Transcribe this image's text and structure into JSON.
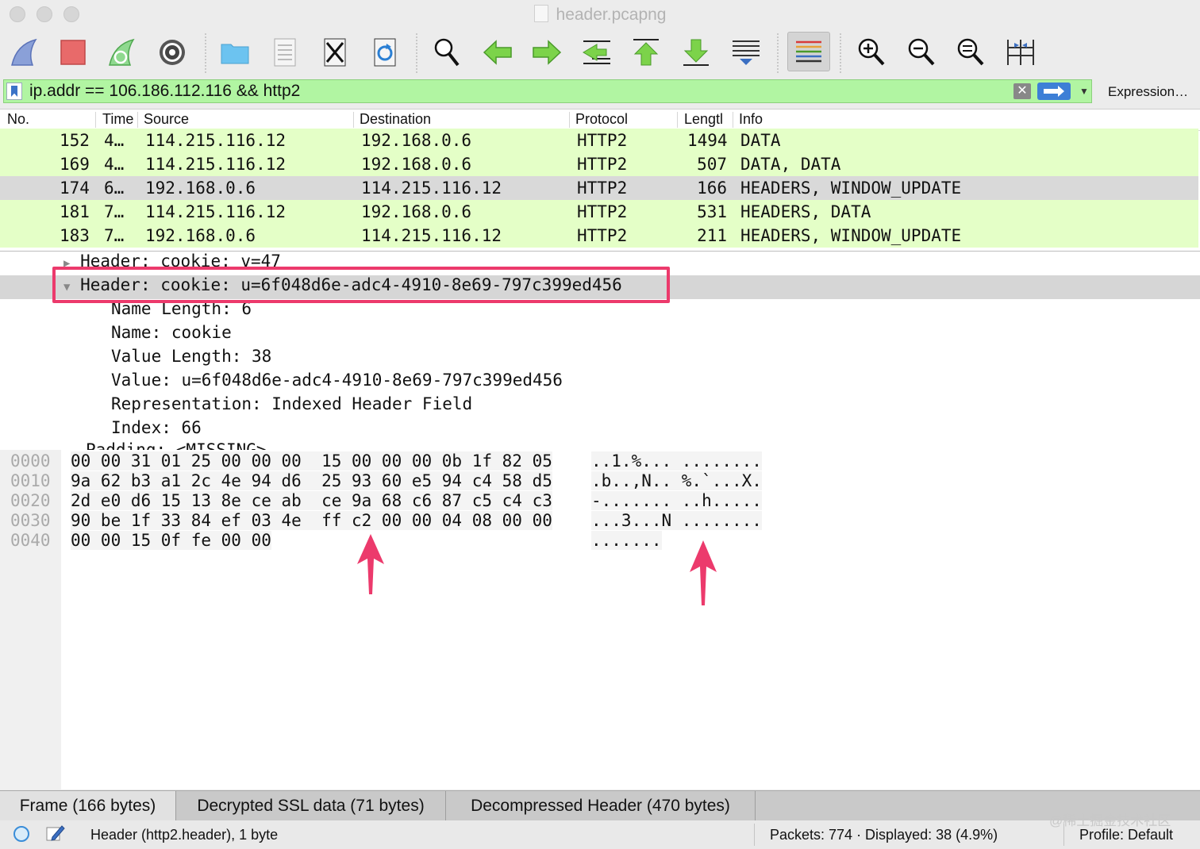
{
  "window": {
    "title": "header.pcapng"
  },
  "toolbar": {
    "buttons": [
      "start-capture",
      "stop-capture",
      "restart-capture",
      "capture-options",
      "open-file",
      "save-file",
      "close-file",
      "reload-file",
      "find-packet",
      "go-back",
      "go-forward",
      "go-to-packet",
      "go-first",
      "go-last",
      "autoscroll",
      "colorize",
      "zoom-in",
      "zoom-out",
      "zoom-normal",
      "resize-columns"
    ]
  },
  "filter": {
    "value": "ip.addr == 106.186.112.116 && http2",
    "clear_label": "✕",
    "expression_label": "Expression…",
    "bg_color": "#b1f5a2"
  },
  "packet_list": {
    "columns": [
      "No.",
      "Time",
      "Source",
      "Destination",
      "Protocol",
      "Lengtl",
      "Info"
    ],
    "rows": [
      {
        "no": "152",
        "time": "4…",
        "source": "114.215.116.12",
        "destination": "192.168.0.6",
        "protocol": "HTTP2",
        "length": "1494",
        "info": "DATA"
      },
      {
        "no": "169",
        "time": "4…",
        "source": "114.215.116.12",
        "destination": "192.168.0.6",
        "protocol": "HTTP2",
        "length": "507",
        "info": "DATA, DATA"
      },
      {
        "no": "174",
        "time": "6…",
        "source": "192.168.0.6",
        "destination": "114.215.116.12",
        "protocol": "HTTP2",
        "length": "166",
        "info": "HEADERS, WINDOW_UPDATE"
      },
      {
        "no": "181",
        "time": "7…",
        "source": "114.215.116.12",
        "destination": "192.168.0.6",
        "protocol": "HTTP2",
        "length": "531",
        "info": "HEADERS, DATA"
      },
      {
        "no": "183",
        "time": "7…",
        "source": "192.168.0.6",
        "destination": "114.215.116.12",
        "protocol": "HTTP2",
        "length": "211",
        "info": "HEADERS, WINDOW_UPDATE"
      }
    ],
    "selected_row_color": "#d9d9d9",
    "row_color": "#e4ffc7"
  },
  "details": {
    "collapsed_header": "Header: cookie: v=47",
    "expanded_header": "Header: cookie: u=6f048d6e-adc4-4910-8e69-797c399ed456",
    "fields": [
      "Name Length: 6",
      "Name: cookie",
      "Value Length: 38",
      "Value: u=6f048d6e-adc4-4910-8e69-797c399ed456",
      "Representation: Indexed Header Field",
      "Index: 66"
    ],
    "partial_row": "Padding: <MISSING>",
    "highlight_color": "#ec3a6c"
  },
  "hex": {
    "rows": [
      {
        "offset": "0000",
        "bytes": "00 00 31 01 25 00 00 00  15 00 00 00 0b 1f 82 05",
        "ascii": "..1.%... ........"
      },
      {
        "offset": "0010",
        "bytes": "9a 62 b3 a1 2c 4e 94 d6  25 93 60 e5 94 c4 58 d5",
        "ascii": ".b..,N.. %.`...X."
      },
      {
        "offset": "0020",
        "bytes": "2d e0 d6 15 13 8e ce ab  ce 9a 68 c6 87 c5 c4 c3",
        "ascii": "-....... ..h....."
      },
      {
        "offset": "0030",
        "bytes": "90 be 1f 33 84 ef 03 4e  ff c2 00 00 04 08 00 00",
        "ascii": "...3...N ........"
      },
      {
        "offset": "0040",
        "bytes": "00 00 15 0f fe 00 00",
        "ascii": "......."
      }
    ]
  },
  "tabs": [
    {
      "label": "Frame (166 bytes)"
    },
    {
      "label": "Decrypted SSL data (71 bytes)"
    },
    {
      "label": "Decompressed Header (470 bytes)"
    }
  ],
  "status": {
    "field_info": "Header (http2.header), 1 byte",
    "packets": "Packets: 774 · Displayed: 38 (4.9%)",
    "profile": "Profile: Default"
  },
  "watermark": "@稀土掘金技术社区"
}
